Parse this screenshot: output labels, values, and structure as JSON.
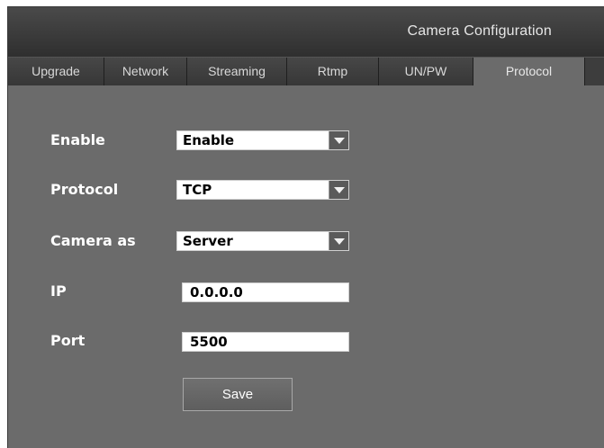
{
  "window": {
    "title": "Camera Configuration"
  },
  "tabs": [
    {
      "label": "Upgrade"
    },
    {
      "label": "Network"
    },
    {
      "label": "Streaming"
    },
    {
      "label": "Rtmp"
    },
    {
      "label": "UN/PW"
    },
    {
      "label": "Protocol",
      "active": true
    }
  ],
  "form": {
    "enable": {
      "label": "Enable",
      "value": "Enable"
    },
    "protocol": {
      "label": "Protocol",
      "value": "TCP"
    },
    "camera_as": {
      "label": "Camera as",
      "value": "Server"
    },
    "ip": {
      "label": "IP",
      "value": "0.0.0.0"
    },
    "port": {
      "label": "Port",
      "value": "5500"
    },
    "save_label": "Save"
  },
  "icons": {
    "dropdown": "chevron-down-icon"
  },
  "colors": {
    "panel": "#6b6b6b",
    "titlebar": "#333333",
    "text": "#ffffff"
  }
}
